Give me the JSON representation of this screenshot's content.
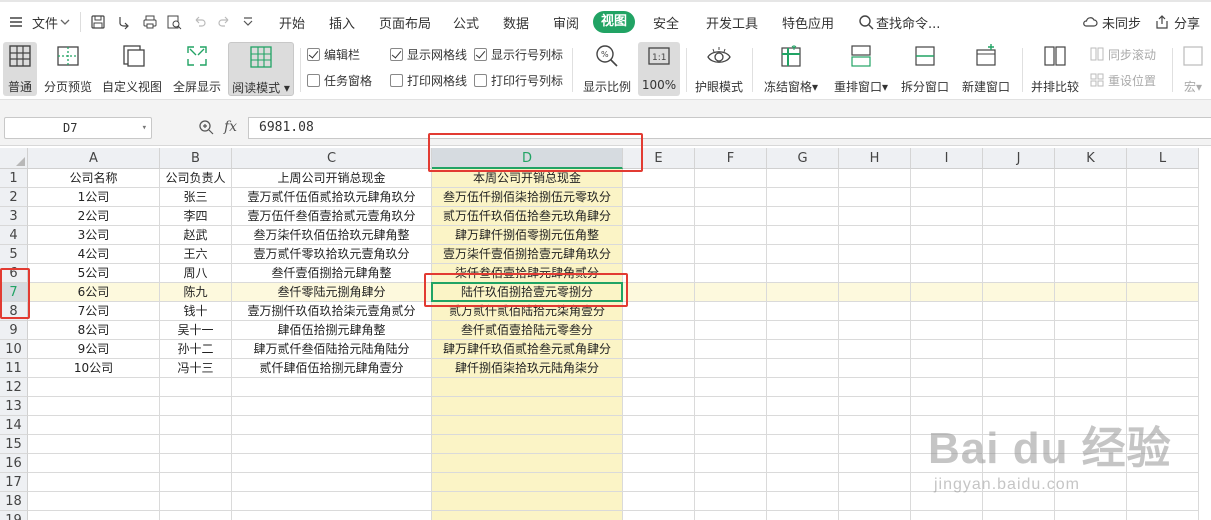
{
  "menu": {
    "file_label": "文件",
    "tabs": [
      "开始",
      "插入",
      "页面布局",
      "公式",
      "数据",
      "审阅"
    ],
    "active_tab": "视图",
    "tabs_after": [
      "安全",
      "开发工具",
      "特色应用"
    ],
    "search_label": "查找命令...",
    "sync_label": "未同步",
    "share_label": "分享"
  },
  "ribbon": {
    "normal": "普通",
    "page_preview": "分页预览",
    "custom_view": "自定义视图",
    "full_screen": "全屏显示",
    "reading_mode": "阅读模式",
    "chk_edit_bar": "编辑栏",
    "chk_task_pane": "任务窗格",
    "chk_show_grid": "显示网格线",
    "chk_print_grid": "打印网格线",
    "chk_show_headers": "显示行号列标",
    "chk_print_headers": "打印行号列标",
    "zoom_ratio": "显示比例",
    "zoom_100": "100%",
    "eye_mode": "护眼模式",
    "freeze": "冻结窗格",
    "rearrange": "重排窗口",
    "split": "拆分窗口",
    "new_window": "新建窗口",
    "side_by_side": "并排比较",
    "sync_scroll": "同步滚动",
    "reset_pos": "重设位置",
    "macro": "宏"
  },
  "formula_bar": {
    "name_box": "D7",
    "fx": "fx",
    "value": "6981.08"
  },
  "columns": [
    "A",
    "B",
    "C",
    "D",
    "E",
    "F",
    "G",
    "H",
    "I",
    "J",
    "K",
    "L"
  ],
  "selected_column": "D",
  "selected_row": 7,
  "table": {
    "headers": [
      "公司名称",
      "公司负责人",
      "上周公司开销总现金",
      "本周公司开销总现金"
    ],
    "rows": [
      [
        "1公司",
        "张三",
        "壹万贰仟伍佰贰拾玖元肆角玖分",
        "叁万伍仟捌佰柒拾捌伍元零玖分"
      ],
      [
        "2公司",
        "李四",
        "壹万伍仟叁佰壹拾贰元壹角玖分",
        "贰万伍仟玖佰伍拾叁元玖角肆分"
      ],
      [
        "3公司",
        "赵武",
        "叁万柒仟玖佰伍拾玖元肆角整",
        "肆万肆仟捌佰零捌元伍角整"
      ],
      [
        "4公司",
        "王六",
        "壹万贰仟零玖拾玖元壹角玖分",
        "壹万柒仟壹佰捌拾壹元肆角玖分"
      ],
      [
        "5公司",
        "周八",
        "叁仟壹佰捌拾元肆角整",
        "柒仟叁佰壹拾肆元肆角贰分"
      ],
      [
        "6公司",
        "陈九",
        "叁仟零陆元捌角肆分",
        "陆仟玖佰捌拾壹元零捌分"
      ],
      [
        "7公司",
        "钱十",
        "壹万捌仟玖佰玖拾柒元壹角贰分",
        "贰万贰仟贰佰陆拾元柒角壹分"
      ],
      [
        "8公司",
        "吴十一",
        "肆佰伍拾捌元肆角整",
        "叁仟贰佰壹拾陆元零叁分"
      ],
      [
        "9公司",
        "孙十二",
        "肆万贰仟叁佰陆拾元陆角陆分",
        "肆万肆仟玖佰贰拾叁元贰角肆分"
      ],
      [
        "10公司",
        "冯十三",
        "贰仟肆佰伍拾捌元肆角壹分",
        "肆仟捌佰柒拾玖元陆角柒分"
      ]
    ]
  },
  "row_numbers": [
    1,
    2,
    3,
    4,
    5,
    6,
    7,
    8,
    9,
    10,
    11,
    12,
    13,
    14,
    15,
    16,
    17,
    18,
    19
  ],
  "watermark": {
    "brand": "Bai du 经验",
    "url": "jingyan.baidu.com"
  },
  "colors": {
    "accent": "#21a364",
    "highlight_column": "#fbf4c6",
    "annotation_red": "#e23b32"
  }
}
